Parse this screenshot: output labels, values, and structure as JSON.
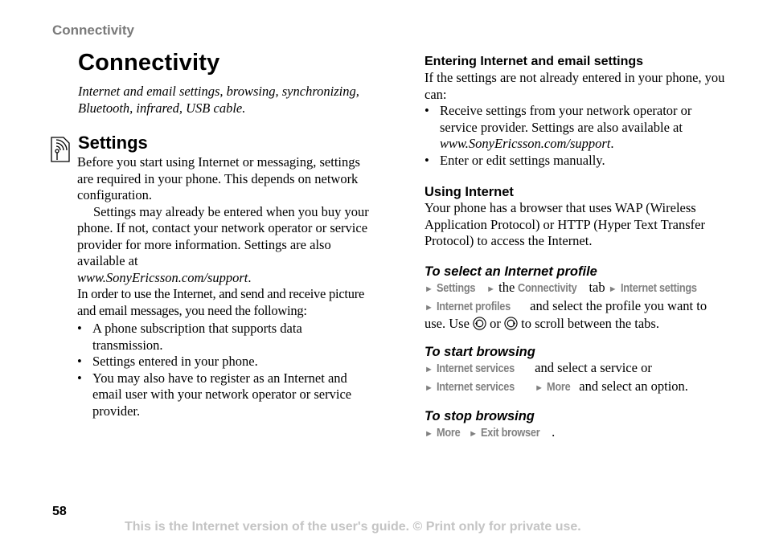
{
  "running_head": "Connectivity",
  "chapter": {
    "title": "Connectivity",
    "intro": "Internet and email settings, browsing, synchronizing, Bluetooth, infrared, USB cable."
  },
  "settings": {
    "icon": "internet-settings-icon",
    "heading": "Settings",
    "p1": "Before you start using Internet or messaging, settings are required in your phone. This depends on network configuration.",
    "p2_a": "Settings may already be entered when you buy your phone. If not, contact your network operator or service provider for more information. Settings are also available at",
    "p2_link": "www.SonyEricsson.com/support",
    "p2_end": ".",
    "p3": "In order to use the Internet, and send and receive picture and email messages, you need the following:",
    "bullets": [
      "A phone subscription that supports data transmission.",
      "Settings entered in your phone.",
      "You may also have to register as an Internet and email user with your network operator or service provider."
    ]
  },
  "entering": {
    "heading": "Entering Internet and email settings",
    "intro": "If the settings are not already entered in your phone, you can:",
    "bullet1_a": "Receive settings from your network operator or service provider. Settings are also available at",
    "bullet1_link": "www.SonyEricsson.com/support",
    "bullet1_end": ".",
    "bullet2": "Enter or edit settings manually."
  },
  "using": {
    "heading": "Using Internet",
    "body": "Your phone has a browser that uses WAP (Wireless Application Protocol) or HTTP (Hyper Text Transfer Protocol) to access the Internet."
  },
  "select_profile": {
    "heading": "To select an Internet profile",
    "menu_settings": "Settings",
    "the": "the",
    "menu_connectivity": "Connectivity",
    "tab": "tab",
    "menu_internet_settings": "Internet settings",
    "menu_internet_profiles": "Internet profiles",
    "text1": "and select the profile you want to use. Use",
    "or": "or",
    "text2": "to scroll between the tabs."
  },
  "start_browsing": {
    "heading": "To start browsing",
    "menu_internet_services": "Internet services",
    "text1": "and select a service or",
    "menu_more": "More",
    "text2": "and select an option."
  },
  "stop_browsing": {
    "heading": "To stop browsing",
    "menu_more": "More",
    "menu_exit": "Exit browser",
    "end": "."
  },
  "arrow": "►",
  "bullet": "•",
  "page_number": "58",
  "footer": "This is the Internet version of the user's guide. © Print only for private use."
}
